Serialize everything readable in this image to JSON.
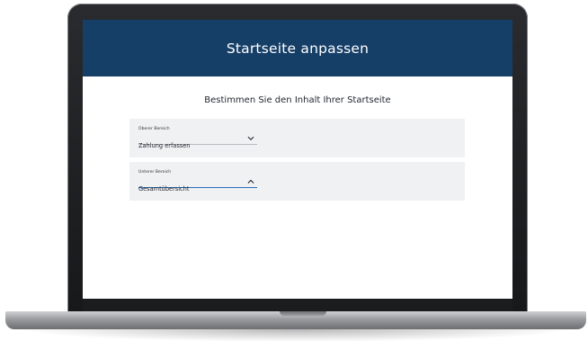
{
  "header": {
    "title": "Startseite anpassen"
  },
  "main": {
    "subtitle": "Bestimmen Sie den Inhalt Ihrer Startseite",
    "fields": [
      {
        "label": "Oberer Bereich",
        "value": "Zahlung erfassen",
        "icon": "chevron-down-icon",
        "expanded": false
      },
      {
        "label": "Unterer Bereich",
        "value": "Gesamtübersicht",
        "icon": "chevron-up-icon",
        "expanded": true
      }
    ]
  },
  "colors": {
    "header_bg": "#163f68",
    "panel_bg": "#f0f1f3",
    "active_underline": "#2a6fc0"
  }
}
